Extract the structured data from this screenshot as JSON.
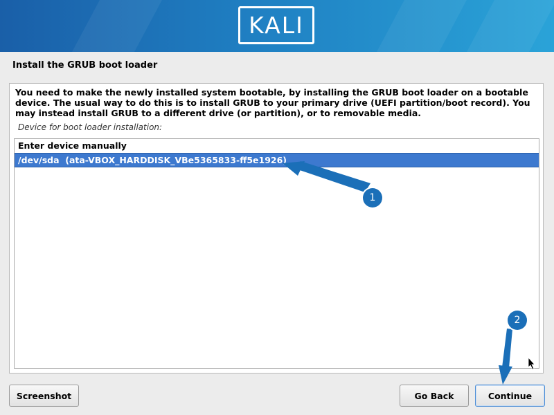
{
  "header": {
    "logo_text": "KALI"
  },
  "page": {
    "title": "Install the GRUB boot loader"
  },
  "content": {
    "description": "You need to make the newly installed system bootable, by installing the GRUB boot loader on a bootable device. The usual way to do this is to install GRUB to your primary drive (UEFI partition/boot record). You may instead install GRUB to a different drive (or partition), or to removable media.",
    "device_label": "Device for boot loader installation:",
    "devices": [
      {
        "label": "Enter device manually",
        "selected": false
      },
      {
        "label": "/dev/sda  (ata-VBOX_HARDDISK_VBe5365833-ff5e1926)",
        "selected": true
      }
    ]
  },
  "buttons": {
    "screenshot": "Screenshot",
    "go_back": "Go Back",
    "continue": "Continue"
  },
  "annotations": [
    {
      "number": "1"
    },
    {
      "number": "2"
    }
  ],
  "colors": {
    "banner_start": "#1a5fa8",
    "banner_end": "#2aa3d8",
    "selection": "#3d79cf",
    "annotation": "#1b6fb8"
  }
}
